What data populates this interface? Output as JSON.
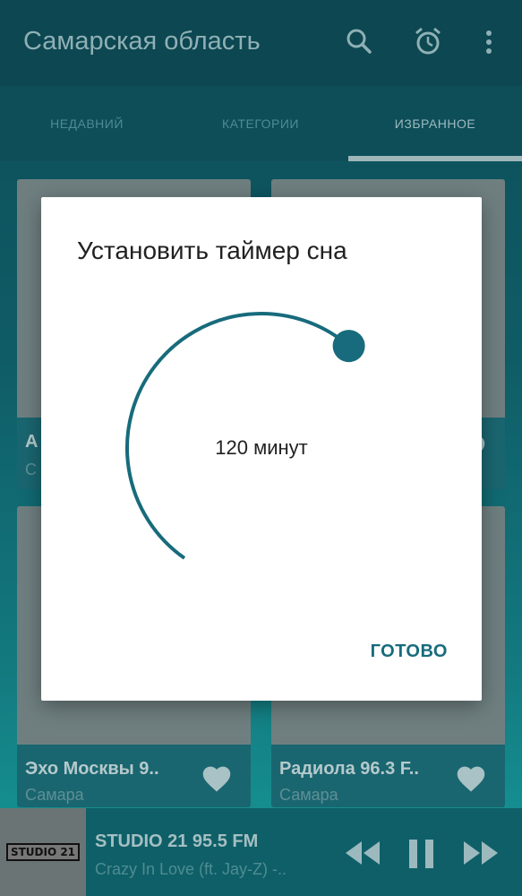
{
  "toolbar": {
    "title": "Самарская область",
    "icons": [
      "search-icon",
      "alarm-icon",
      "more-vert-icon"
    ]
  },
  "tabs": [
    {
      "label": "НЕДАВНИЙ",
      "active": false
    },
    {
      "label": "КАТЕГОРИИ",
      "active": false
    },
    {
      "label": "ИЗБРАННОЕ",
      "active": true
    }
  ],
  "cards": [
    {
      "title": "А",
      "subtitle": "С"
    },
    {
      "title": "",
      "subtitle": ""
    },
    {
      "title": "Эхо Москвы 9..",
      "subtitle": "Самара"
    },
    {
      "title": "Радиола 96.3 F..",
      "subtitle": "Самара"
    }
  ],
  "player": {
    "logo_text": "STUDIO 21",
    "station": "STUDIO 21 95.5 FM",
    "track": "Crazy In Love (ft. Jay-Z) -..",
    "controls": [
      "rewind-icon",
      "pause-icon",
      "fast-forward-icon"
    ]
  },
  "dialog": {
    "title": "Установить таймер сна",
    "value_text": "120 минут",
    "dial_fraction": 0.64,
    "done_label": "ГОТОВО"
  },
  "colors": {
    "accent": "#176b7c",
    "dialog_bg": "#ffffff",
    "toolbar": "#0c4752"
  }
}
